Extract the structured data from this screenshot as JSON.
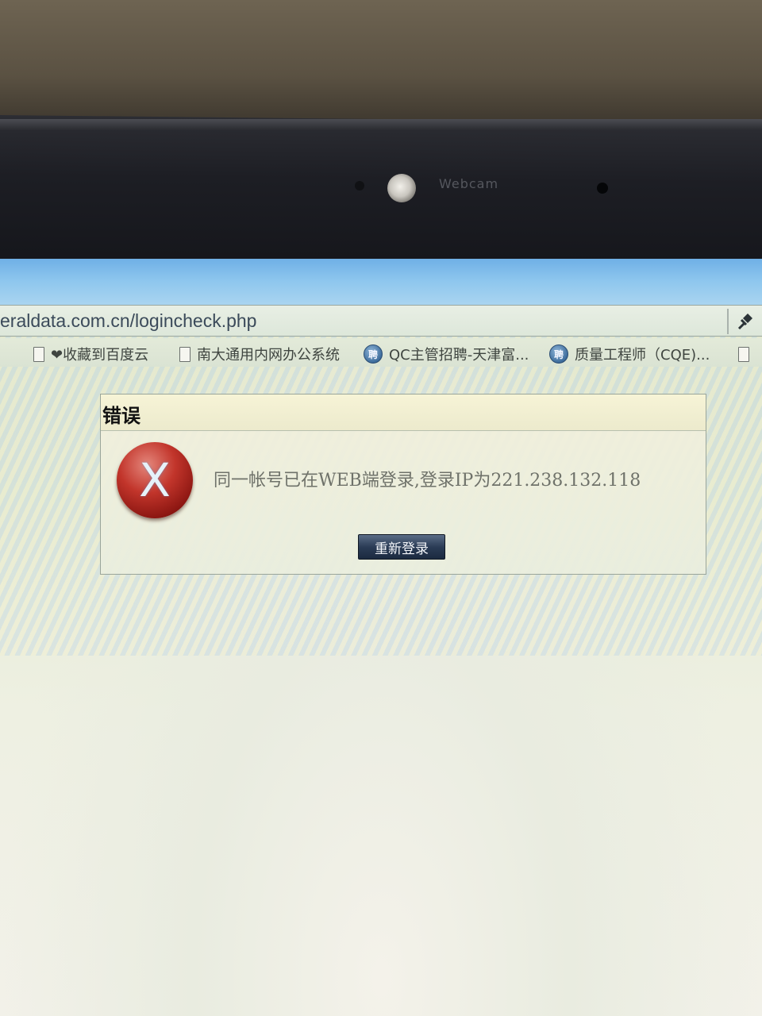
{
  "hardware": {
    "webcam_label": "Webcam"
  },
  "browser": {
    "address_url": "eraldata.com.cn/logincheck.php",
    "bookmarks": [
      {
        "label": "❤收藏到百度云",
        "icon": "page-icon"
      },
      {
        "label": "南大通用内网办公系统",
        "icon": "page-icon"
      },
      {
        "label": "QC主管招聘-天津富...",
        "icon": "globe-icon"
      },
      {
        "label": "质量工程师（CQE)...",
        "icon": "globe-icon"
      }
    ],
    "globe_icon_glyph": "聘"
  },
  "dialog": {
    "title": "错误",
    "icon": "error-x-icon",
    "icon_glyph": "X",
    "message": "同一帐号已在WEB端登录,登录IP为221.238.132.118",
    "button_label": "重新登录"
  },
  "colors": {
    "error_red": "#c2352b",
    "button_navy": "#2b3c56"
  }
}
